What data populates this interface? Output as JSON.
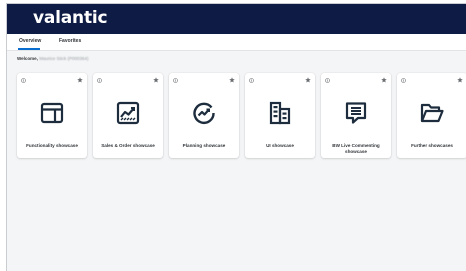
{
  "app": {
    "brand": "valantic"
  },
  "tabs": [
    {
      "label": "Overview"
    },
    {
      "label": "Favorites"
    }
  ],
  "welcome": {
    "prefix": "Welcome,",
    "name": "Maurice Stick (P000364)"
  },
  "tiles": [
    {
      "title": "Functionality showcase",
      "icon": "app-layout-icon"
    },
    {
      "title": "Sales & Order showcase",
      "icon": "line-chart-icon"
    },
    {
      "title": "Planning showcase",
      "icon": "trend-circle-icon"
    },
    {
      "title": "UI showcase",
      "icon": "building-icon"
    },
    {
      "title": "BW Live Commenting showcase",
      "icon": "comment-icon"
    },
    {
      "title": "Further showcases",
      "icon": "folder-open-icon"
    }
  ],
  "colors": {
    "shellbar": "#0d1b45",
    "accent": "#0a6ed1",
    "background": "#f4f5f6"
  }
}
